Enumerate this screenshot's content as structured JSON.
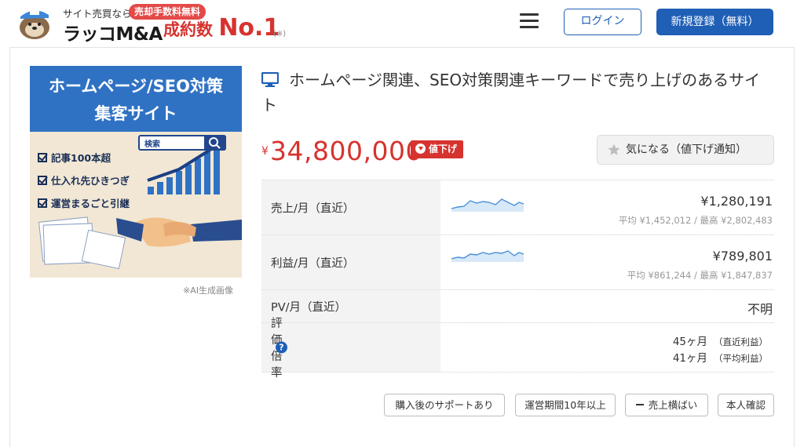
{
  "header": {
    "tagline": "サイト売買なら",
    "free_badge": "売却手数料無料",
    "brand": "ラッコM&A",
    "rank_text": "成約数",
    "rank_no": "No.1",
    "rank_note": "(※)",
    "login_label": "ログイン",
    "register_label": "新規登録（無料）"
  },
  "listing": {
    "thumbnail": {
      "title_line1": "ホームページ/SEO対策",
      "title_line2": "集客サイト",
      "search_text": "検索",
      "features": [
        "記事100本超",
        "仕入れ先ひきつぎ",
        "運営まるごと引継"
      ],
      "ai_note": "※AI生成画像"
    },
    "title": "ホームページ関連、SEO対策関連キーワードで売り上げのあるサイト",
    "price_currency": "¥",
    "price": "34,800,000",
    "price_down_label": "値下げ",
    "favorite_label": "気になる（値下げ通知）",
    "metrics": {
      "sales": {
        "label": "売上/月（直近）",
        "value": "¥1,280,191",
        "sub": "平均 ¥1,452,012 / 最高 ¥2,802,483"
      },
      "profit": {
        "label": "利益/月（直近）",
        "value": "¥789,801",
        "sub": "平均 ¥861,244 / 最高 ¥1,847,837"
      },
      "pv": {
        "label": "PV/月（直近）",
        "value": "不明"
      },
      "multiple": {
        "label": "評価倍率",
        "help": "?",
        "recent_value": "45ヶ月",
        "recent_label": "（直近利益）",
        "avg_value": "41ヶ月",
        "avg_label": "（平均利益）"
      }
    },
    "tags": [
      "購入後のサポートあり",
      "運営期間10年以上",
      "売上横ばい",
      "本人確認"
    ]
  },
  "colors": {
    "accent_blue": "#1f5fb5",
    "price_red": "#d6332f",
    "spark_blue": "#4a90d9"
  }
}
